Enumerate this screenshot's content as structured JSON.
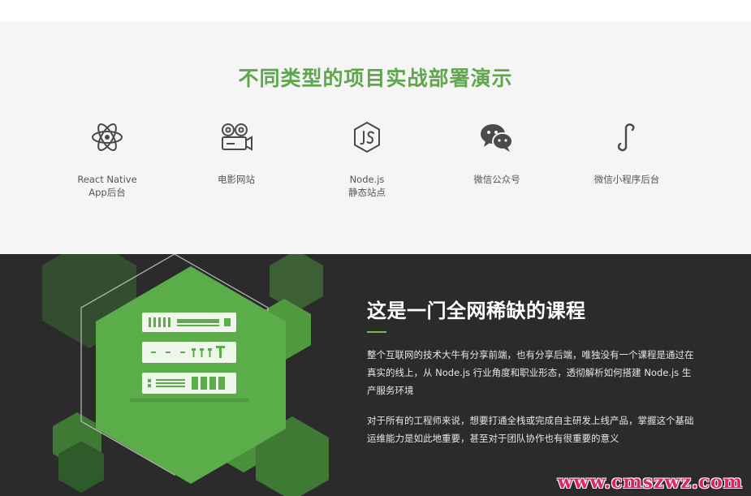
{
  "showcase": {
    "title": "不同类型的项目实战部署演示",
    "items": [
      {
        "icon": "react-icon",
        "line1": "React Native",
        "line2": "App后台"
      },
      {
        "icon": "movie-projector-icon",
        "line1": "电影网站",
        "line2": ""
      },
      {
        "icon": "nodejs-icon",
        "line1": "Node.js",
        "line2": "静态站点"
      },
      {
        "icon": "wechat-icon",
        "line1": "微信公众号",
        "line2": ""
      },
      {
        "icon": "mini-program-icon",
        "line1": "微信小程序后台",
        "line2": ""
      }
    ]
  },
  "course": {
    "title": "这是一门全网稀缺的课程",
    "paragraph1": "整个互联网的技术大牛有分享前端，也有分享后端，唯独没有一个课程是通过在真实的线上，从 Node.js 行业角度和职业形态，透彻解析如何搭建 Node.js 生产服务环境",
    "paragraph2": "对于所有的工程师来说，想要打通全栈或完成自主研发上线产品，掌握这个基础运维能力是如此地重要，甚至对于团队协作也有很重要的意义"
  },
  "watermark": "www.cmszwz.com",
  "colors": {
    "accent_green": "#5fa64d",
    "dark_bg": "#2b2b2b",
    "light_bg": "#f5f5f5",
    "watermark_red": "#e0245e"
  }
}
